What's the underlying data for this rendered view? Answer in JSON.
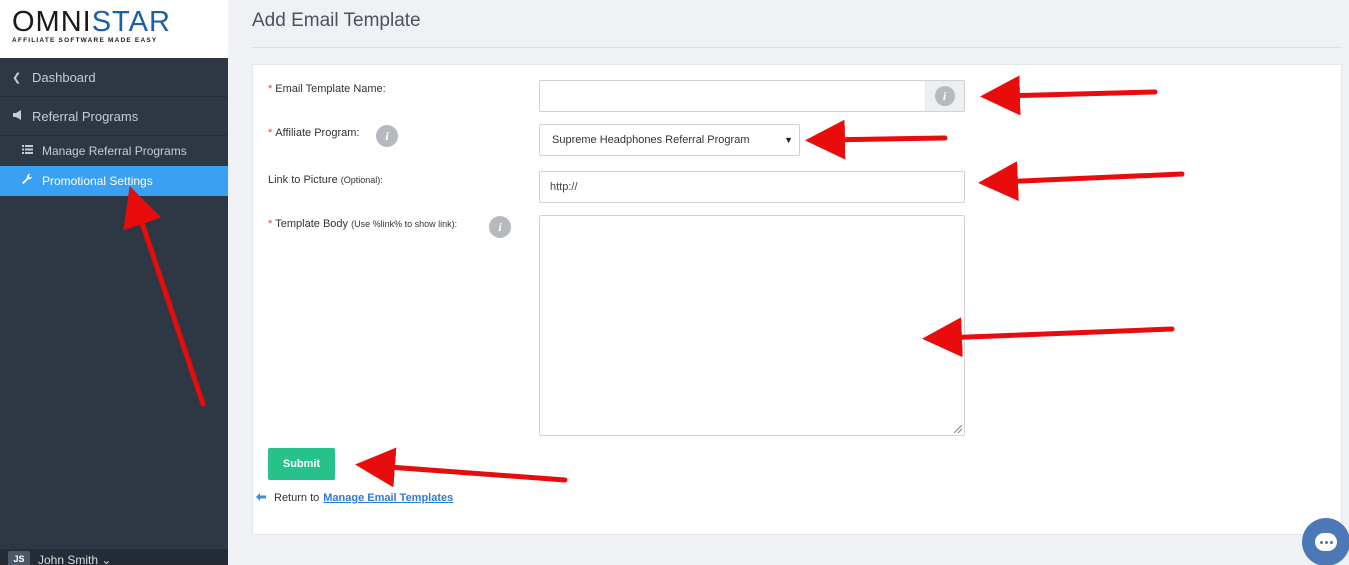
{
  "logo": {
    "name_a": "OMNI",
    "name_b": "ST",
    "name_c": "A",
    "name_d": "R",
    "tagline": "AFFILIATE SOFTWARE MADE EASY"
  },
  "sidebar": {
    "items": [
      {
        "label": "Dashboard",
        "icon": "chevron-left-icon"
      },
      {
        "label": "Referral Programs",
        "icon": "megaphone-icon"
      }
    ],
    "sub_items": [
      {
        "label": "Manage Referral Programs",
        "icon": "list-icon",
        "active": false
      },
      {
        "label": "Promotional Settings",
        "icon": "wrench-icon",
        "active": true
      }
    ],
    "user": {
      "initials": "JS",
      "name": "John Smith ⌄"
    }
  },
  "page": {
    "title": "Add Email Template"
  },
  "form": {
    "template_name": {
      "label": "Email Template Name:",
      "required_mark": "*",
      "value": ""
    },
    "affiliate_program": {
      "label": "Affiliate Program:",
      "required_mark": "*",
      "selected": "Supreme Headphones Referral Program"
    },
    "picture_link": {
      "label": "Link to Picture",
      "hint": "(Optional):",
      "value": "http://"
    },
    "template_body": {
      "label": "Template Body",
      "hint": "(Use %link% to show link):",
      "required_mark": "*",
      "value": ""
    },
    "info_glyph": "i",
    "submit_label": "Submit",
    "return_prefix": "Return to",
    "return_link": "Manage Email Templates"
  },
  "colors": {
    "sidebar_bg": "#2e3744",
    "active_item": "#3aa0f3",
    "submit": "#26c28b",
    "link": "#2a7fcf",
    "annotation_arrow": "#e80c0c",
    "chat": "#4d78b8"
  },
  "icons": {
    "chat": "chat-bubble-icon",
    "return": "arrow-left-icon",
    "info": "info-icon"
  }
}
